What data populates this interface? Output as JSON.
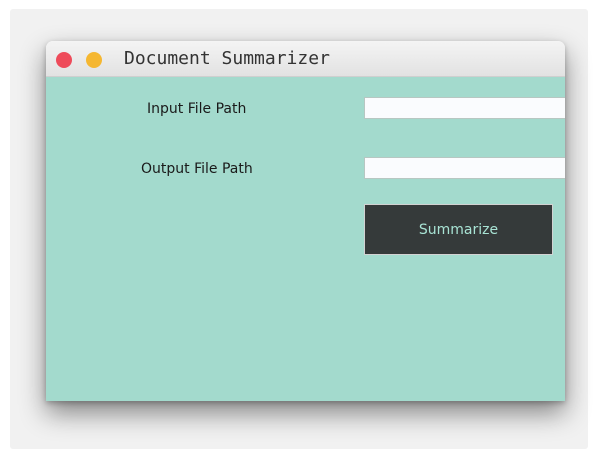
{
  "window": {
    "title": "Document Summarizer"
  },
  "form": {
    "input_label": "Input File Path",
    "input_value": "",
    "output_label": "Output File Path",
    "output_value": "",
    "summarize_label": "Summarize"
  },
  "colors": {
    "background": "#a3dacd",
    "button": "#353a3a",
    "button_text": "#a8e3d4",
    "close": "#ee4b5a",
    "minimize": "#f5b731"
  },
  "icons": [
    "close-icon",
    "minimize-icon"
  ]
}
